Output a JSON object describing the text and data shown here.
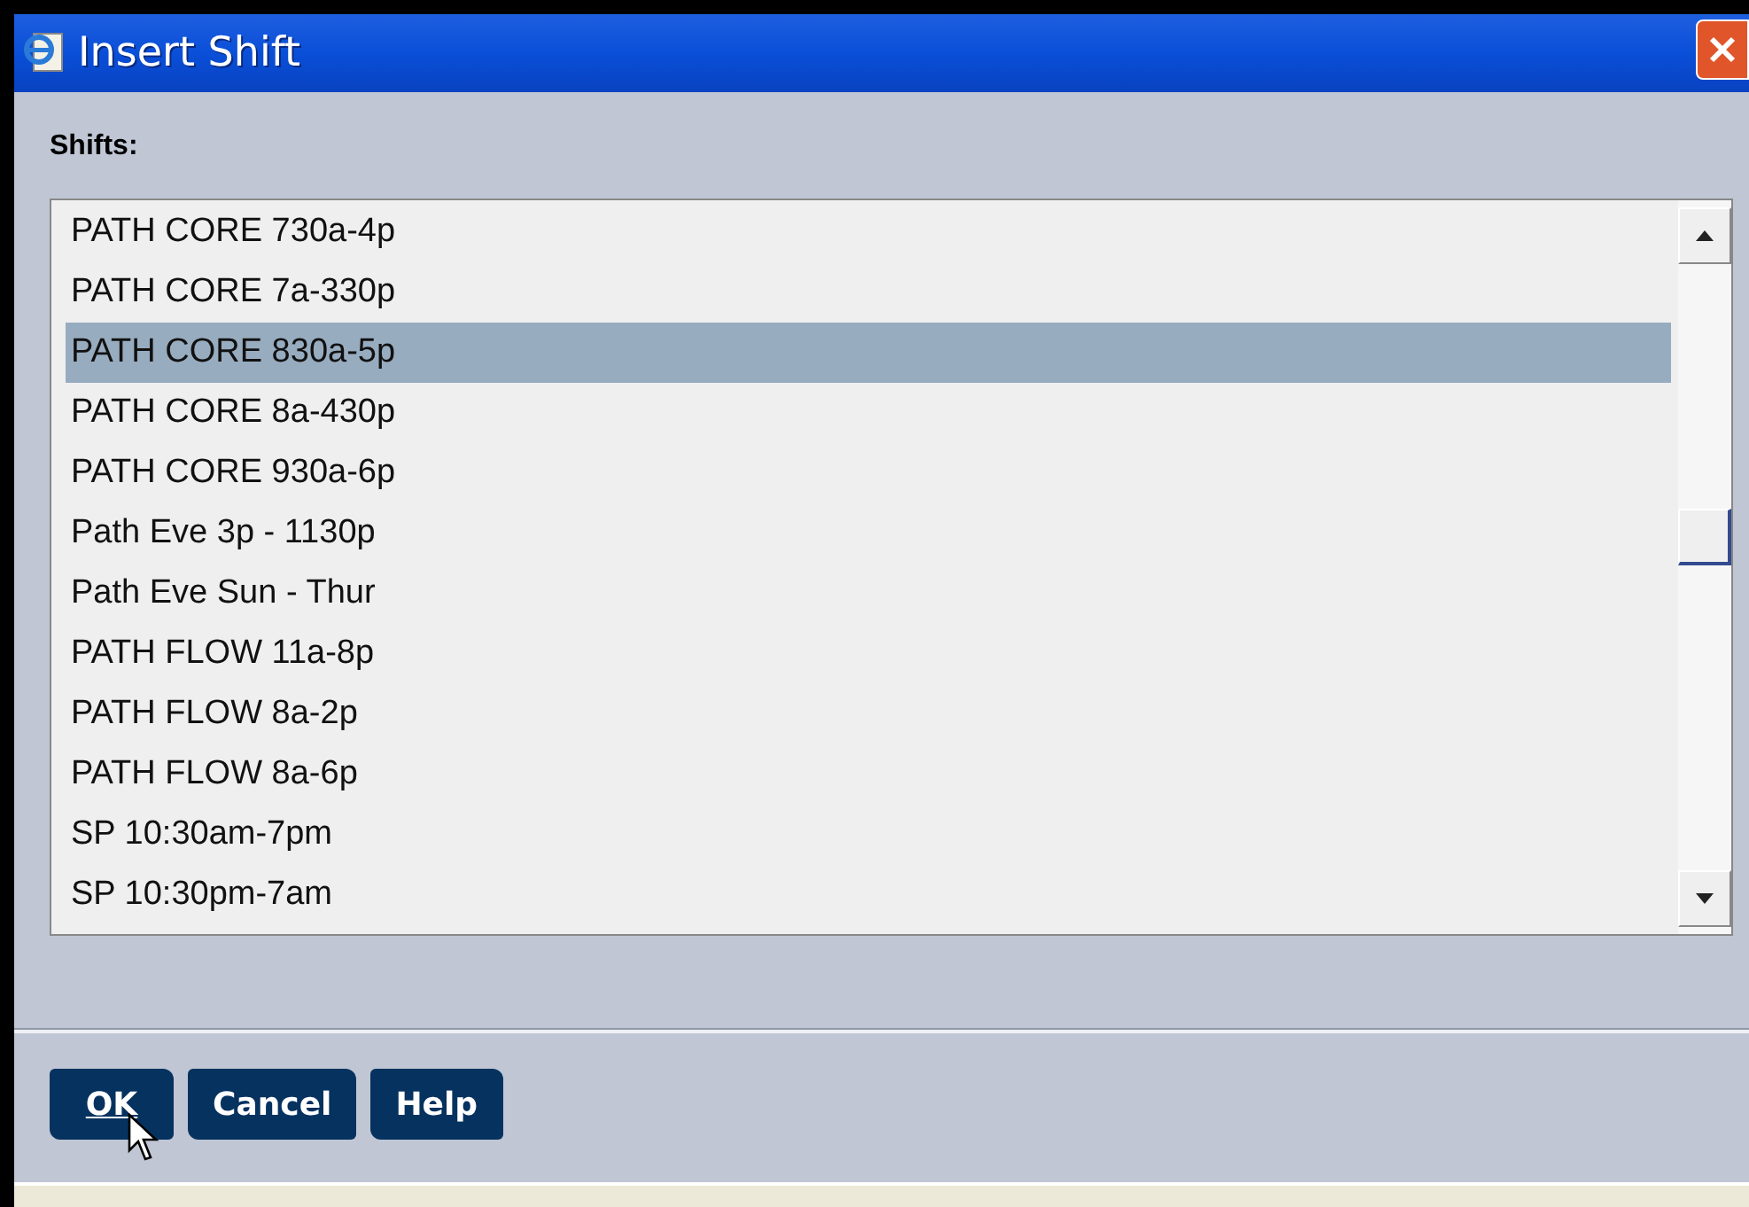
{
  "window": {
    "title": "Insert Shift"
  },
  "list_label": "Shifts:",
  "shifts": [
    {
      "label": "PATH CORE 730a-4p",
      "selected": false
    },
    {
      "label": "PATH CORE 7a-330p",
      "selected": false
    },
    {
      "label": "PATH CORE 830a-5p",
      "selected": true
    },
    {
      "label": "PATH CORE 8a-430p",
      "selected": false
    },
    {
      "label": "PATH CORE 930a-6p",
      "selected": false
    },
    {
      "label": "Path Eve 3p - 1130p",
      "selected": false
    },
    {
      "label": "Path Eve Sun - Thur",
      "selected": false
    },
    {
      "label": "PATH FLOW 11a-8p",
      "selected": false
    },
    {
      "label": "PATH FLOW 8a-2p",
      "selected": false
    },
    {
      "label": "PATH FLOW 8a-6p",
      "selected": false
    },
    {
      "label": "SP 10:30am-7pm",
      "selected": false
    },
    {
      "label": "SP 10:30pm-7am",
      "selected": false
    }
  ],
  "buttons": [
    "OK",
    "Cancel",
    "Help"
  ]
}
